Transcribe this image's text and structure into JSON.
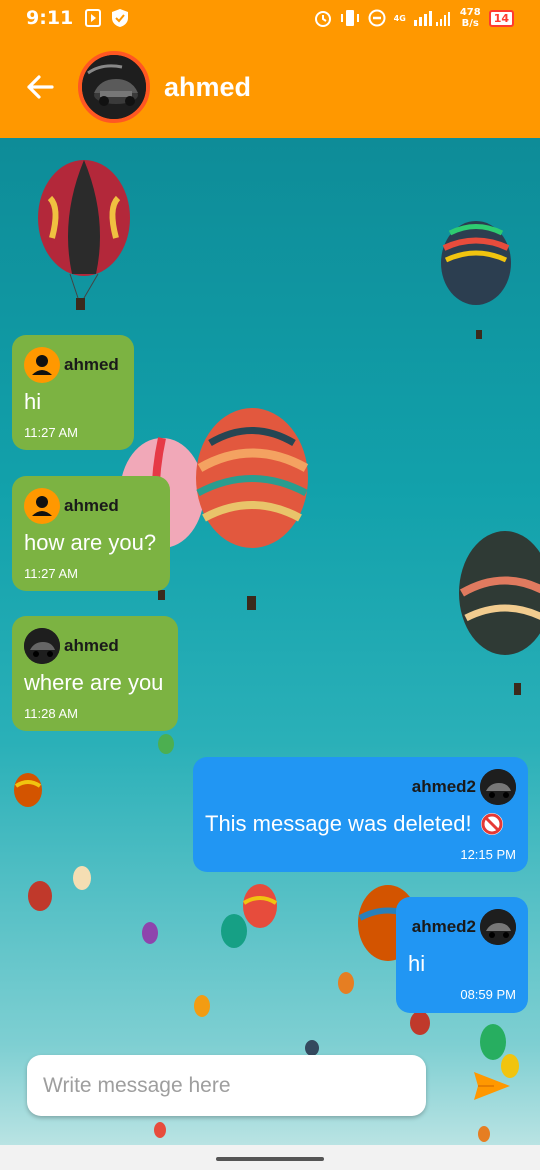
{
  "status_bar": {
    "time": "9:11",
    "net_speed_value": "478",
    "net_speed_unit": "B/s",
    "network_label": "4G",
    "battery": "14"
  },
  "header": {
    "title": "ahmed",
    "back_icon": "arrow-left-icon",
    "avatar_icon": "profile-photo-car"
  },
  "messages": [
    {
      "direction": "in",
      "sender": "ahmed",
      "text": "hi",
      "time": "11:27 AM",
      "avatar": "default-person-icon"
    },
    {
      "direction": "in",
      "sender": "ahmed",
      "text": "how are you?",
      "time": "11:27 AM",
      "avatar": "default-person-icon"
    },
    {
      "direction": "in",
      "sender": "ahmed",
      "text": "where are you",
      "time": "11:28 AM",
      "avatar": "profile-photo-car"
    },
    {
      "direction": "out",
      "sender": "ahmed2",
      "text": "This message was deleted!",
      "time": "12:15 PM",
      "avatar": "profile-photo-car",
      "deleted_icon": "prohibited-icon"
    },
    {
      "direction": "out",
      "sender": "ahmed2",
      "text": "hi",
      "time": "08:59 PM",
      "avatar": "profile-photo-car"
    }
  ],
  "composer": {
    "placeholder": "Write message here",
    "value": "",
    "send_icon": "send-icon"
  },
  "colors": {
    "accent": "#ff9800",
    "incoming_bubble": "#7cb342",
    "outgoing_bubble": "#2196f3"
  }
}
